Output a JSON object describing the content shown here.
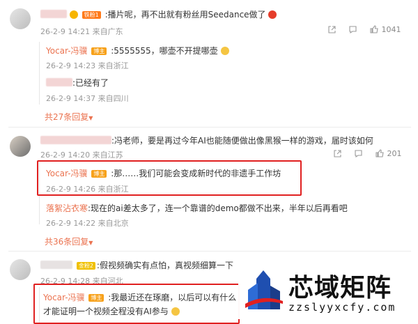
{
  "c1": {
    "text": ":播片呢，再不出就有粉丝用Seedance做了",
    "badge": "铁粉1",
    "meta": "26-2-9 14:21 来自广东",
    "likes": "1041"
  },
  "r1": {
    "name": "Yocar-冯骥",
    "badge": "博主",
    "text": ":5555555，哪壶不开提哪壶",
    "meta": "26-2-9 14:23 来自浙江"
  },
  "r2": {
    "text": ":已经有了",
    "meta": "26-2-9 14:37 来自四川"
  },
  "more1": "共27条回复",
  "c2": {
    "text": ":冯老师，要是再过今年AI也能随便做出像黑猴一样的游戏，届时该如何",
    "meta": "26-2-9 14:20 来自江苏",
    "likes": "201"
  },
  "r3": {
    "name": "Yocar-冯骥",
    "badge": "博主",
    "text": ":那……我们可能会变成新时代的非遗手工作坊",
    "meta": "26-2-9 14:26 来自浙江"
  },
  "r4": {
    "name": "落絮沾衣寒",
    "text": ":现在的ai差太多了，连一个靠谱的demo都做不出来，半年以后再看吧",
    "meta": "26-2-9 14:22 来自北京"
  },
  "more2": "共36条回复",
  "c3": {
    "badge": "金粉2",
    "text": ":假视频确实有点怕，真视频细算一下",
    "meta": "26-2-9 14:28 来自河北"
  },
  "r5": {
    "name": "Yocar-冯骥",
    "badge": "博主",
    "text1": ":我最近还在琢磨，以后可以有什么",
    "text2": "才能证明一个视频全程没有AI参与"
  },
  "watermark": {
    "title": "芯域矩阵",
    "url": "zzslyyxcfy.com"
  },
  "colors": {
    "accent": "#eb7350",
    "highlight": "#e02020",
    "meta": "#999999"
  }
}
